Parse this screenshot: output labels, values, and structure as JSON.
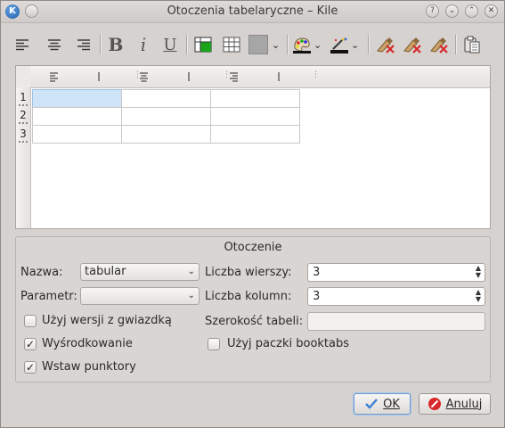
{
  "window": {
    "title": "Otoczenia tabelaryczne – Kile",
    "app_icon": "K",
    "help_glyph": "?",
    "shade_glyph": "⌄",
    "max_glyph": "⌃",
    "close_glyph": "✕"
  },
  "toolbar": {
    "icons": [
      "align-left-icon",
      "align-center-icon",
      "align-right-icon",
      "bold-icon",
      "italic-icon",
      "underline-icon",
      "join-cells-icon",
      "split-cells-icon",
      "background-color-icon",
      "text-color-icon",
      "border-color-icon",
      "clear-text-icon",
      "clear-attributes-icon",
      "clear-all-icon",
      "paste-icon"
    ],
    "bold_glyph": "B",
    "italic_glyph": "i",
    "underline_glyph": "U"
  },
  "table": {
    "row_labels": [
      "1",
      "2",
      "3"
    ],
    "rows": 3,
    "columns": 3,
    "column_header_glyphs": [
      "≡",
      "|",
      "⋮"
    ]
  },
  "group": {
    "title": "Otoczenie",
    "name_label": "Nazwa:",
    "name_value": "tabular",
    "param_label": "Parametr:",
    "param_value": "",
    "rows_label": "Liczba wierszy:",
    "rows_value": "3",
    "cols_label": "Liczba kolumn:",
    "cols_value": "3",
    "width_label": "Szerokość tabeli:",
    "width_value": "",
    "starred_label": "Użyj wersji z gwiazdką",
    "starred_checked": false,
    "center_label": "Wyśrodkowanie",
    "center_checked": true,
    "booktabs_label": "Użyj paczki booktabs",
    "booktabs_checked": false,
    "bullets_label": "Wstaw punktory",
    "bullets_checked": true
  },
  "buttons": {
    "ok_label": "OK",
    "cancel_label": "Anuluj"
  },
  "glyphs": {
    "combo_arrow": "⌄",
    "spin_up": "▲",
    "spin_down": "▼",
    "check": "✓"
  },
  "colors": {
    "selected_cell": "#cfe4f7",
    "join_icon_green": "#1aa41a",
    "gray_swatch": "#a6a6a6",
    "cancel_red": "#d9282b",
    "ok_blue": "#3b7fd1"
  }
}
